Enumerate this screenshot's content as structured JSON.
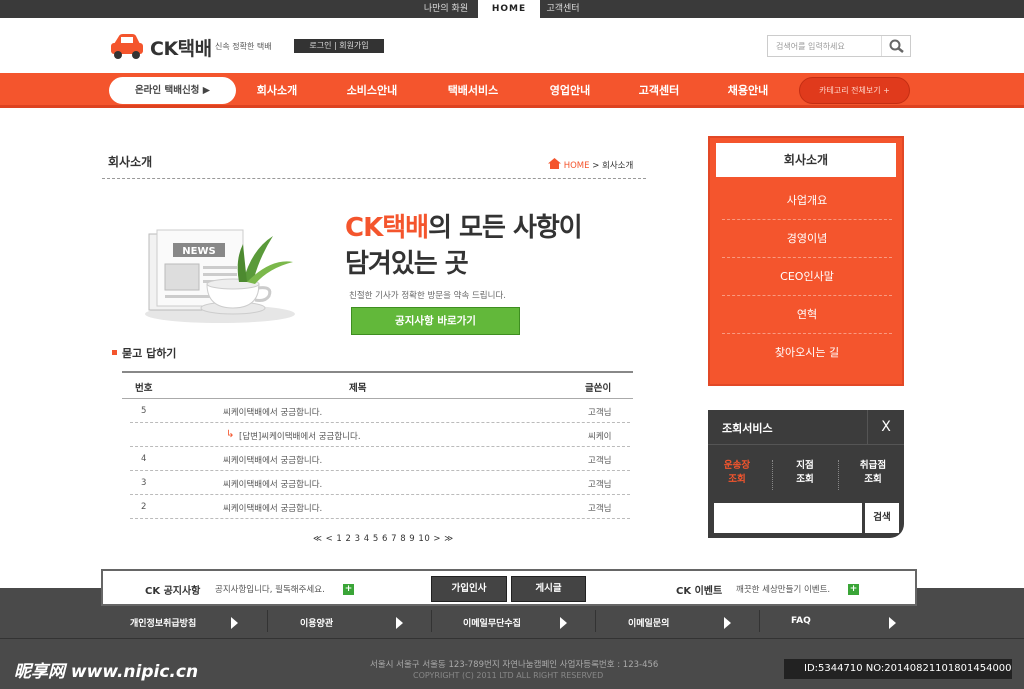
{
  "topbar": {
    "my_page": "나만의 화원",
    "home": "HOME",
    "customer": "고객센터"
  },
  "header": {
    "logo": "CK택배",
    "tagline": "신속 정확한 택배",
    "login": "로그인 | 회원가입",
    "search_placeholder": "검색어를 입력하세요"
  },
  "nav": {
    "online_apply": "온라인 택배신청 ▶",
    "items": [
      "회사소개",
      "소비스안내",
      "택배서비스",
      "영업안내",
      "고객센터",
      "채용안내"
    ],
    "category": "카테고리 전체보기 +"
  },
  "page": {
    "title": "회사소개",
    "crumb_home": "HOME",
    "crumb_sep": ">",
    "crumb_current": "회사소개"
  },
  "banner": {
    "brand": "CK택배",
    "title_rest": "의 모든 사항이",
    "title_line2": "담겨있는 곳",
    "subtitle": "친절한 기사가 정확한 방문을 약속 드립니다.",
    "button": "공지사항 바로가기",
    "news_label": "NEWS"
  },
  "qa": {
    "title": "묻고 답하기",
    "headers": {
      "no": "번호",
      "subject": "제목",
      "writer": "글쓴이"
    },
    "rows": [
      {
        "no": "5",
        "subject": "씨케이택배에서 궁금합니다.",
        "writer": "고객님",
        "reply": false
      },
      {
        "no": "",
        "subject": "[답변]씨케이택배에서 궁금합니다.",
        "writer": "씨케이",
        "reply": true
      },
      {
        "no": "4",
        "subject": "씨케이택배에서 궁금합니다.",
        "writer": "고객님",
        "reply": false
      },
      {
        "no": "3",
        "subject": "씨케이택배에서 궁금합니다.",
        "writer": "고객님",
        "reply": false
      },
      {
        "no": "2",
        "subject": "씨케이택배에서 궁금합니다.",
        "writer": "고객님",
        "reply": false
      }
    ],
    "pagination": "≪ < 1 2 3 4 5 6 7 8 9 10 > ≫"
  },
  "sidebar": {
    "title": "회사소개",
    "items": [
      "사업개요",
      "경영이념",
      "CEO인사말",
      "연혁",
      "찾아오시는 길"
    ]
  },
  "lookup": {
    "title": "조회서비스",
    "close": "X",
    "items": [
      "운송장\n조회",
      "지점\n조회",
      "취급점\n조회"
    ],
    "search_btn": "검색"
  },
  "footer": {
    "notice_label": "CK 공지사항",
    "notice_text": "공지사항입니다, 필독해주세요.",
    "btn_join": "가입인사",
    "btn_board": "게시글",
    "event_label": "CK 이벤트",
    "event_text": "깨끗한 세상만들기 이벤트.",
    "plus": "+",
    "links": [
      "개인정보취급방침",
      "이용양관",
      "이메일무단수집",
      "이메일문의",
      "FAQ"
    ],
    "address": "서울시 서울구 서울동 123-789번지 자연나눔캠페인 사업자등록번호 : 123-456",
    "copyright": "COPYRIGHT (C) 2011 LTD ALL RIGHT RESERVED"
  },
  "watermark": {
    "text": "昵享网 www.nipic.cn",
    "id": "ID:5344710 NO:20140821101801454000"
  }
}
